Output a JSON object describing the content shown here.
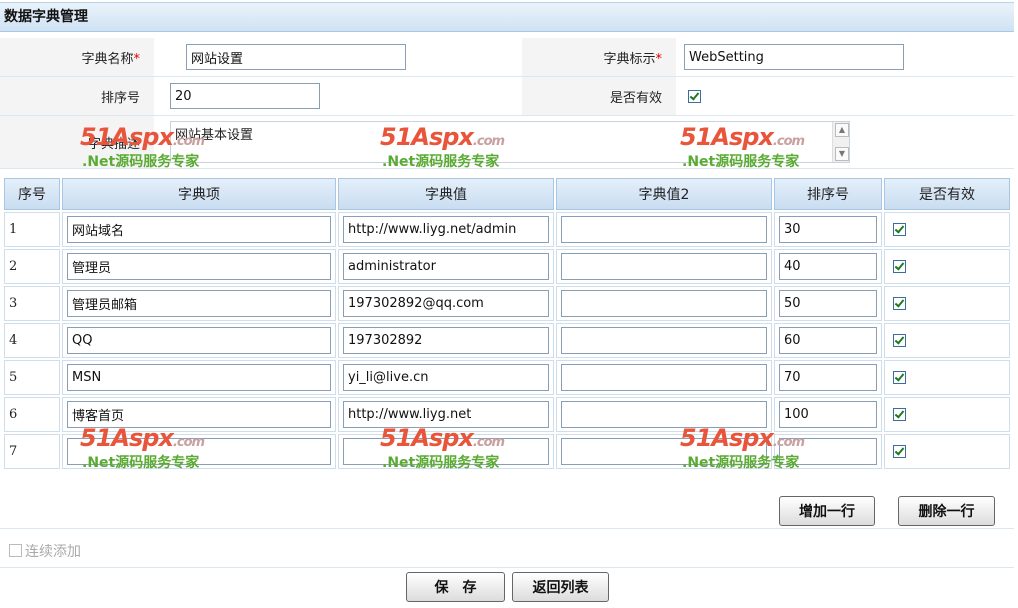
{
  "page": {
    "title": "数据字典管理"
  },
  "form": {
    "name_label": "字典名称",
    "name_value": "网站设置",
    "key_label": "字典标示",
    "key_value": "WebSetting",
    "required_mark": "*",
    "order_label": "排序号",
    "order_value": "20",
    "valid_label": "是否有效",
    "valid_checked": true,
    "desc_label": "字典描述",
    "desc_value": "网站基本设置"
  },
  "grid": {
    "headers": [
      "序号",
      "字典项",
      "字典值",
      "字典值2",
      "排序号",
      "是否有效"
    ],
    "rows": [
      {
        "idx": "1",
        "item": "网站域名",
        "value": "http://www.liyg.net/admin",
        "value2": "",
        "order": "30",
        "valid": true
      },
      {
        "idx": "2",
        "item": "管理员",
        "value": "administrator",
        "value2": "",
        "order": "40",
        "valid": true
      },
      {
        "idx": "3",
        "item": "管理员邮箱",
        "value": "197302892@qq.com",
        "value2": "",
        "order": "50",
        "valid": true
      },
      {
        "idx": "4",
        "item": "QQ",
        "value": "197302892",
        "value2": "",
        "order": "60",
        "valid": true
      },
      {
        "idx": "5",
        "item": "MSN",
        "value": "yi_li@live.cn",
        "value2": "",
        "order": "70",
        "valid": true
      },
      {
        "idx": "6",
        "item": "博客首页",
        "value": "http://www.liyg.net",
        "value2": "",
        "order": "100",
        "valid": true
      },
      {
        "idx": "7",
        "item": "",
        "value": "",
        "value2": "",
        "order": "",
        "valid": true
      }
    ]
  },
  "actions": {
    "add_row": "增加一行",
    "delete_row": "删除一行",
    "continuous_add": "连续添加",
    "save": "保　存",
    "back_to_list": "返回列表"
  },
  "watermark": {
    "brand": "51Aspx",
    "domain": ".com",
    "slogan": ".Net源码服务专家"
  }
}
